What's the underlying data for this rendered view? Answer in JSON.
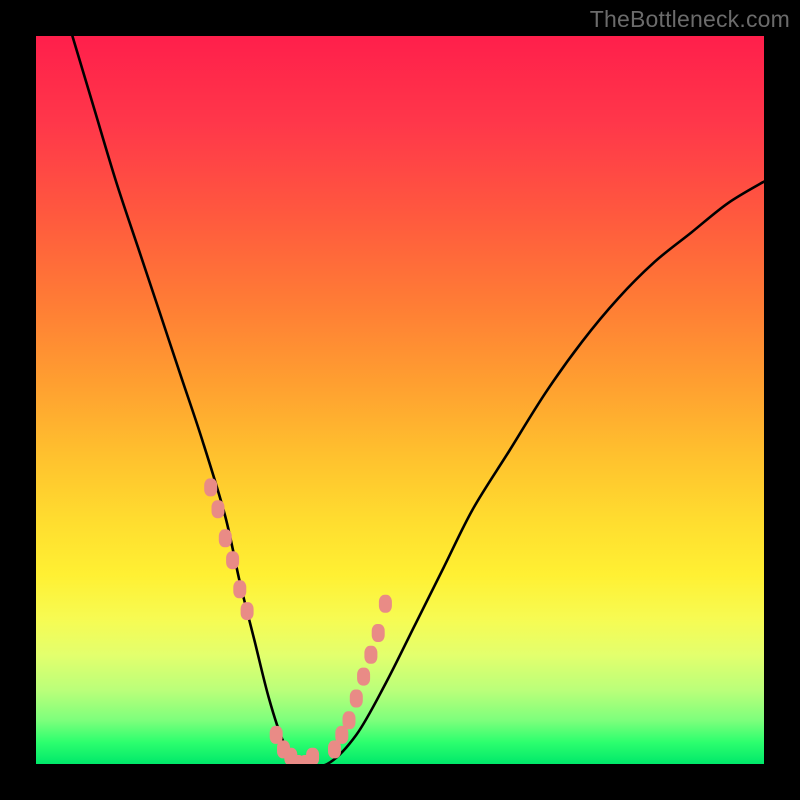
{
  "watermark": "TheBottleneck.com",
  "chart_data": {
    "type": "line",
    "title": "",
    "xlabel": "",
    "ylabel": "",
    "xlim": [
      0,
      100
    ],
    "ylim": [
      0,
      100
    ],
    "curve": {
      "name": "bottleneck-curve",
      "x": [
        5,
        8,
        11,
        14,
        17,
        20,
        23,
        26,
        28,
        30,
        32,
        34,
        36,
        40,
        44,
        48,
        52,
        56,
        60,
        65,
        70,
        75,
        80,
        85,
        90,
        95,
        100
      ],
      "y": [
        100,
        90,
        80,
        71,
        62,
        53,
        44,
        34,
        25,
        17,
        9,
        3,
        0,
        0,
        4,
        11,
        19,
        27,
        35,
        43,
        51,
        58,
        64,
        69,
        73,
        77,
        80
      ]
    },
    "markers": {
      "name": "highlight-points",
      "color": "#e98b86",
      "x": [
        24,
        25,
        26,
        27,
        28,
        29,
        33,
        34,
        35,
        36,
        37,
        38,
        41,
        42,
        43,
        44,
        45,
        46,
        47,
        48
      ],
      "y": [
        38,
        35,
        31,
        28,
        24,
        21,
        4,
        2,
        1,
        0,
        0,
        1,
        2,
        4,
        6,
        9,
        12,
        15,
        18,
        22
      ]
    },
    "gradient_stops": [
      {
        "pos": 0.0,
        "color": "#ff1f4b"
      },
      {
        "pos": 0.5,
        "color": "#ffb82e"
      },
      {
        "pos": 0.8,
        "color": "#f6ff4e"
      },
      {
        "pos": 1.0,
        "color": "#00e86a"
      }
    ]
  }
}
